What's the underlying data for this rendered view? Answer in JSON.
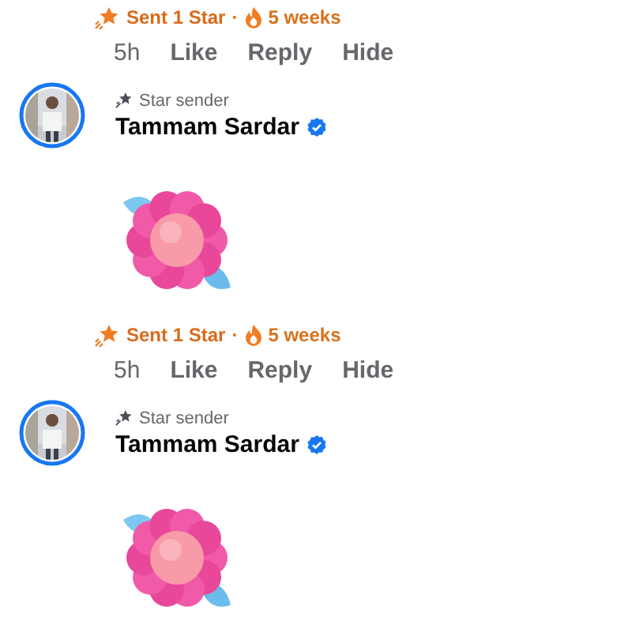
{
  "comments": [
    {
      "stars": {
        "sent": "Sent 1 Star",
        "separator": "·",
        "streak": "5 weeks"
      },
      "actions": [
        "5h",
        "Like",
        "Reply",
        "Hide"
      ]
    },
    {
      "badge": "Star sender",
      "name": "Tammam Sardar",
      "verified": true,
      "sticker": {
        "kind": "flower"
      },
      "stars": {
        "sent": "Sent 1 Star",
        "separator": "·",
        "streak": "5 weeks"
      },
      "actions": [
        "5h",
        "Like",
        "Reply",
        "Hide"
      ]
    },
    {
      "badge": "Star sender",
      "name": "Tammam Sardar",
      "verified": true,
      "sticker": {
        "kind": "flower"
      }
    }
  ]
}
